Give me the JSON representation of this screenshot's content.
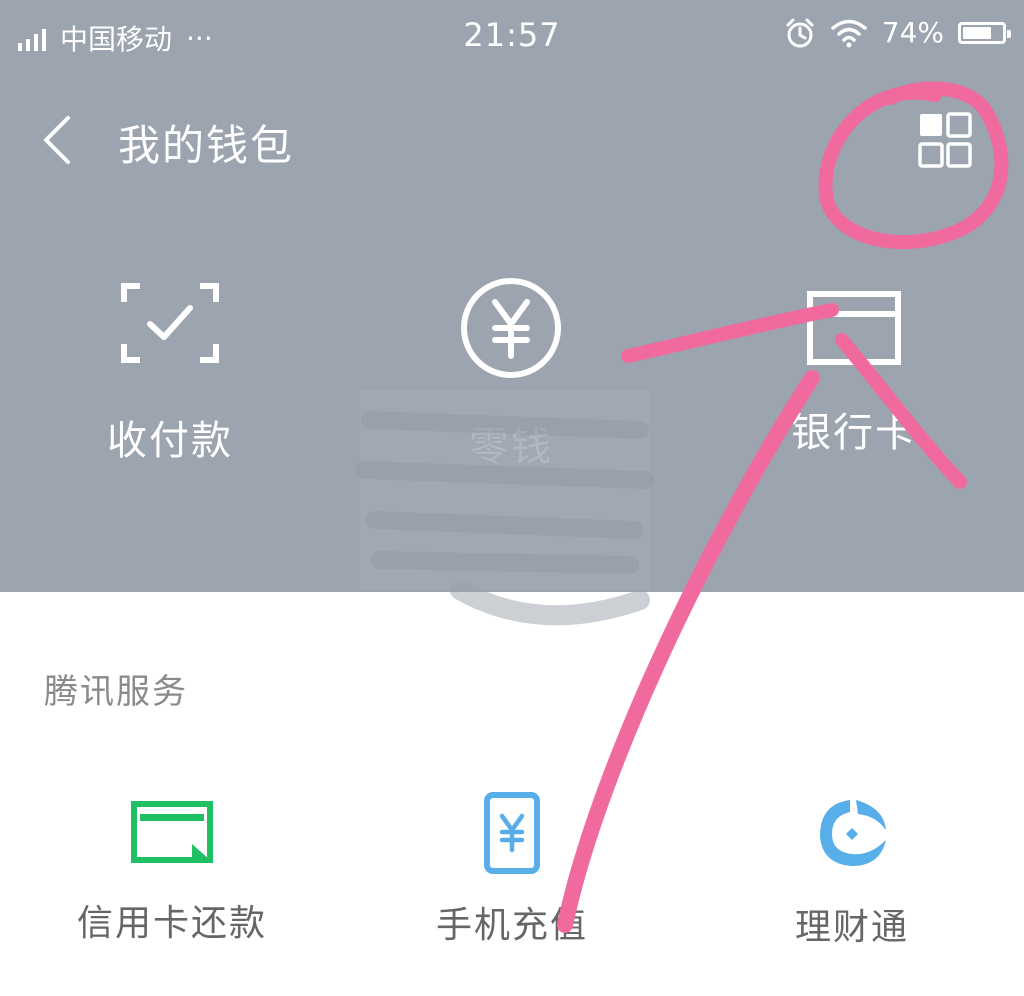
{
  "status_bar": {
    "carrier": "中国移动",
    "more": "···",
    "time": "21:57",
    "battery_percent": "74%",
    "battery_level": 0.74,
    "icons": [
      "signal-icon",
      "alarm-icon",
      "wifi-icon",
      "battery-icon"
    ]
  },
  "header": {
    "title": "我的钱包",
    "back_icon": "chevron-left-icon",
    "menu_icon": "grid-icon"
  },
  "top_actions": [
    {
      "label": "收付款",
      "icon": "scan-check-icon"
    },
    {
      "label": "零钱",
      "icon": "yuan-circle-icon"
    },
    {
      "label": "银行卡",
      "icon": "card-icon"
    }
  ],
  "services": {
    "section_title": "腾讯服务",
    "items": [
      {
        "label": "信用卡还款",
        "icon": "credit-card-repay-icon"
      },
      {
        "label": "手机充值",
        "icon": "phone-topup-icon"
      },
      {
        "label": "理财通",
        "icon": "wealth-icon"
      }
    ]
  },
  "colors": {
    "panel_bg": "#9ca4b0",
    "annotation": "#f06a9e",
    "green": "#1fbf63",
    "blue": "#58aee8"
  }
}
